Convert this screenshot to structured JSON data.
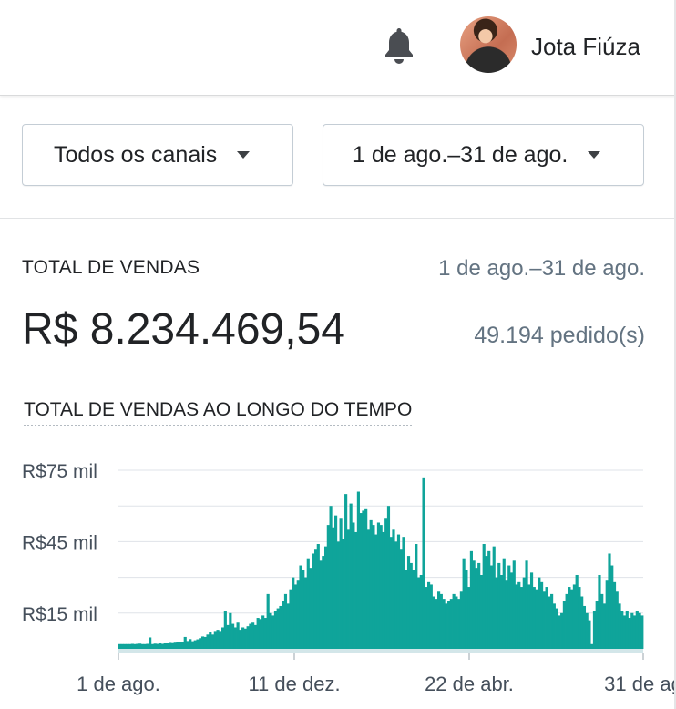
{
  "header": {
    "bell_icon": "bell-icon",
    "user_name": "Jota Fiúza"
  },
  "filters": {
    "channel": "Todos os canais",
    "date_range": "1 de ago.–31 de ago."
  },
  "summary": {
    "title": "TOTAL DE VENDAS",
    "range": "1 de ago.–31 de ago.",
    "total": "R$ 8.234.469,54",
    "orders": "49.194 pedido(s)"
  },
  "chart_title": "TOTAL DE VENDAS AO LONGO DO TEMPO",
  "colors": {
    "series": "#0fa49a",
    "baseline": "#d3e6e9",
    "grid": "#dfe3e8",
    "text": "#212326",
    "muted": "#637381"
  },
  "chart_data": {
    "type": "area",
    "title": "TOTAL DE VENDAS AO LONGO DO TEMPO",
    "ytick_labels": [
      "R$15 mil",
      "R$45 mil",
      "R$75 mil"
    ],
    "yticks": [
      15000,
      45000,
      75000
    ],
    "ylim": [
      0,
      82000
    ],
    "xtick_labels": [
      "1 de ago.",
      "11 de dez.",
      "22 de abr.",
      "31 de ag"
    ],
    "grid": true,
    "series": [
      {
        "values": [
          2000,
          2000,
          2000,
          2000,
          2000,
          2100,
          2000,
          2100,
          2200,
          2000,
          2000,
          2100,
          4800,
          2000,
          2200,
          2100,
          2300,
          2100,
          2300,
          2300,
          2500,
          2400,
          2600,
          2800,
          3000,
          3000,
          5000,
          3300,
          4100,
          3200,
          3600,
          4000,
          4500,
          5200,
          5000,
          6000,
          7000,
          6000,
          7500,
          8000,
          7500,
          9000,
          16000,
          10000,
          15000,
          10500,
          9000,
          11000,
          8000,
          9000,
          8500,
          9500,
          10500,
          11000,
          10000,
          13000,
          12500,
          14000,
          13000,
          23000,
          15000,
          14000,
          16000,
          17000,
          18000,
          20000,
          23000,
          19000,
          25000,
          30000,
          27000,
          29000,
          35000,
          33000,
          30000,
          38000,
          34000,
          40000,
          42000,
          44000,
          37000,
          39000,
          43000,
          52000,
          60000,
          51000,
          56000,
          45000,
          55000,
          46000,
          65000,
          50000,
          61000,
          53000,
          49000,
          66000,
          57000,
          58000,
          59000,
          50000,
          54000,
          52000,
          48000,
          53000,
          52000,
          49000,
          55000,
          60000,
          47000,
          50000,
          45000,
          48000,
          42000,
          47000,
          33000,
          39000,
          36000,
          33000,
          44000,
          30000,
          31000,
          72000,
          26000,
          28000,
          27000,
          22000,
          21000,
          24000,
          23000,
          21000,
          19000,
          20000,
          21000,
          23000,
          22000,
          21000,
          24000,
          38000,
          33000,
          26000,
          41000,
          37000,
          34000,
          36000,
          31000,
          44000,
          39000,
          41000,
          35000,
          43000,
          30000,
          36000,
          31000,
          38000,
          29000,
          35000,
          32000,
          37000,
          27000,
          28000,
          26000,
          30000,
          37000,
          27000,
          32000,
          26000,
          25000,
          30000,
          28000,
          24000,
          26000,
          22000,
          23000,
          19000,
          17000,
          14000,
          15000,
          20000,
          23000,
          26000,
          25000,
          27000,
          31000,
          26000,
          22000,
          18000,
          15000,
          12000,
          2000,
          16000,
          20000,
          31000,
          23000,
          19000,
          29000,
          40000,
          35000,
          28000,
          24000,
          19000,
          16000,
          14000,
          16000,
          13000,
          15000,
          14000,
          16000,
          15000,
          14000
        ]
      }
    ]
  }
}
